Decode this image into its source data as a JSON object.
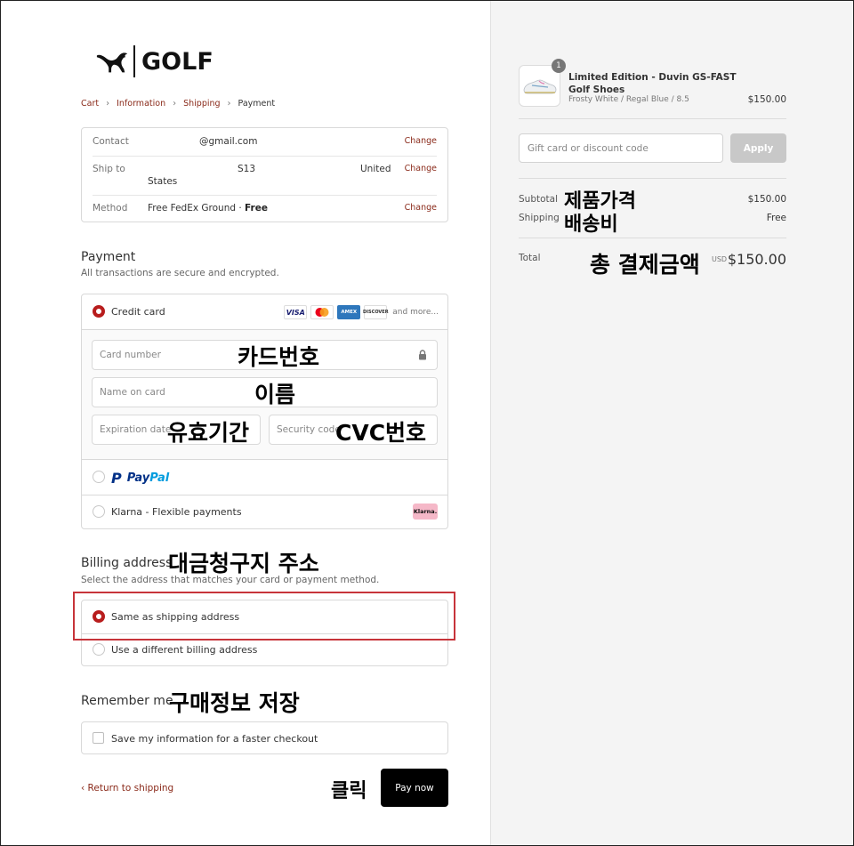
{
  "brand": {
    "word": "GOLF"
  },
  "breadcrumb": {
    "cart": "Cart",
    "information": "Information",
    "shipping": "Shipping",
    "payment": "Payment",
    "separator": "›"
  },
  "review": {
    "contact_label": "Contact",
    "contact_value": "@gmail.com",
    "shipto_label": "Ship to",
    "shipto_value1": "S13",
    "shipto_value2": "United",
    "shipto_value3": "States",
    "method_label": "Method",
    "method_value": "Free FedEx Ground · ",
    "method_free": "Free",
    "change": "Change"
  },
  "payment": {
    "title": "Payment",
    "subtitle": "All transactions are secure and encrypted.",
    "credit_card_label": "Credit card",
    "card_logos": [
      "VISA",
      "",
      "AMEX",
      "DISCOVER"
    ],
    "and_more": "and more...",
    "card_number_placeholder": "Card number",
    "name_placeholder": "Name on card",
    "expiry_placeholder": "Expiration date",
    "security_placeholder": "Security code",
    "paypal_p": "P",
    "paypal_word1": "Pay",
    "paypal_word2": "Pal",
    "klarna_label": "Klarna - Flexible payments",
    "klarna_badge": "Klarna."
  },
  "billing": {
    "title": "Billing address",
    "subtitle": "Select the address that matches your card or payment method.",
    "same_label": "Same as shipping address",
    "different_label": "Use a different billing address"
  },
  "remember": {
    "title": "Remember me",
    "save_label": "Save my information for a faster checkout"
  },
  "footer": {
    "back_link": "‹ Return to shipping",
    "pay_button": "Pay now"
  },
  "summary": {
    "quantity": "1",
    "product_name": "Limited Edition - Duvin GS-FAST Golf Shoes",
    "product_variant": "Frosty White / Regal Blue / 8.5",
    "product_price": "$150.00",
    "gift_placeholder": "Gift card or discount code",
    "apply_button": "Apply",
    "subtotal_label": "Subtotal",
    "subtotal_value": "$150.00",
    "shipping_label": "Shipping",
    "shipping_value": "Free",
    "total_label": "Total",
    "currency": "USD",
    "total_value": "$150.00"
  },
  "annotations": {
    "card_number": "카드번호",
    "name": "이름",
    "expiry": "유효기간",
    "cvc": "CVC번호",
    "billing": "대금청구지 주소",
    "remember": "구매정보 저장",
    "click": "클릭",
    "product_price": "제품가격",
    "shipping_fee": "배송비",
    "total": "총 결제금액"
  }
}
